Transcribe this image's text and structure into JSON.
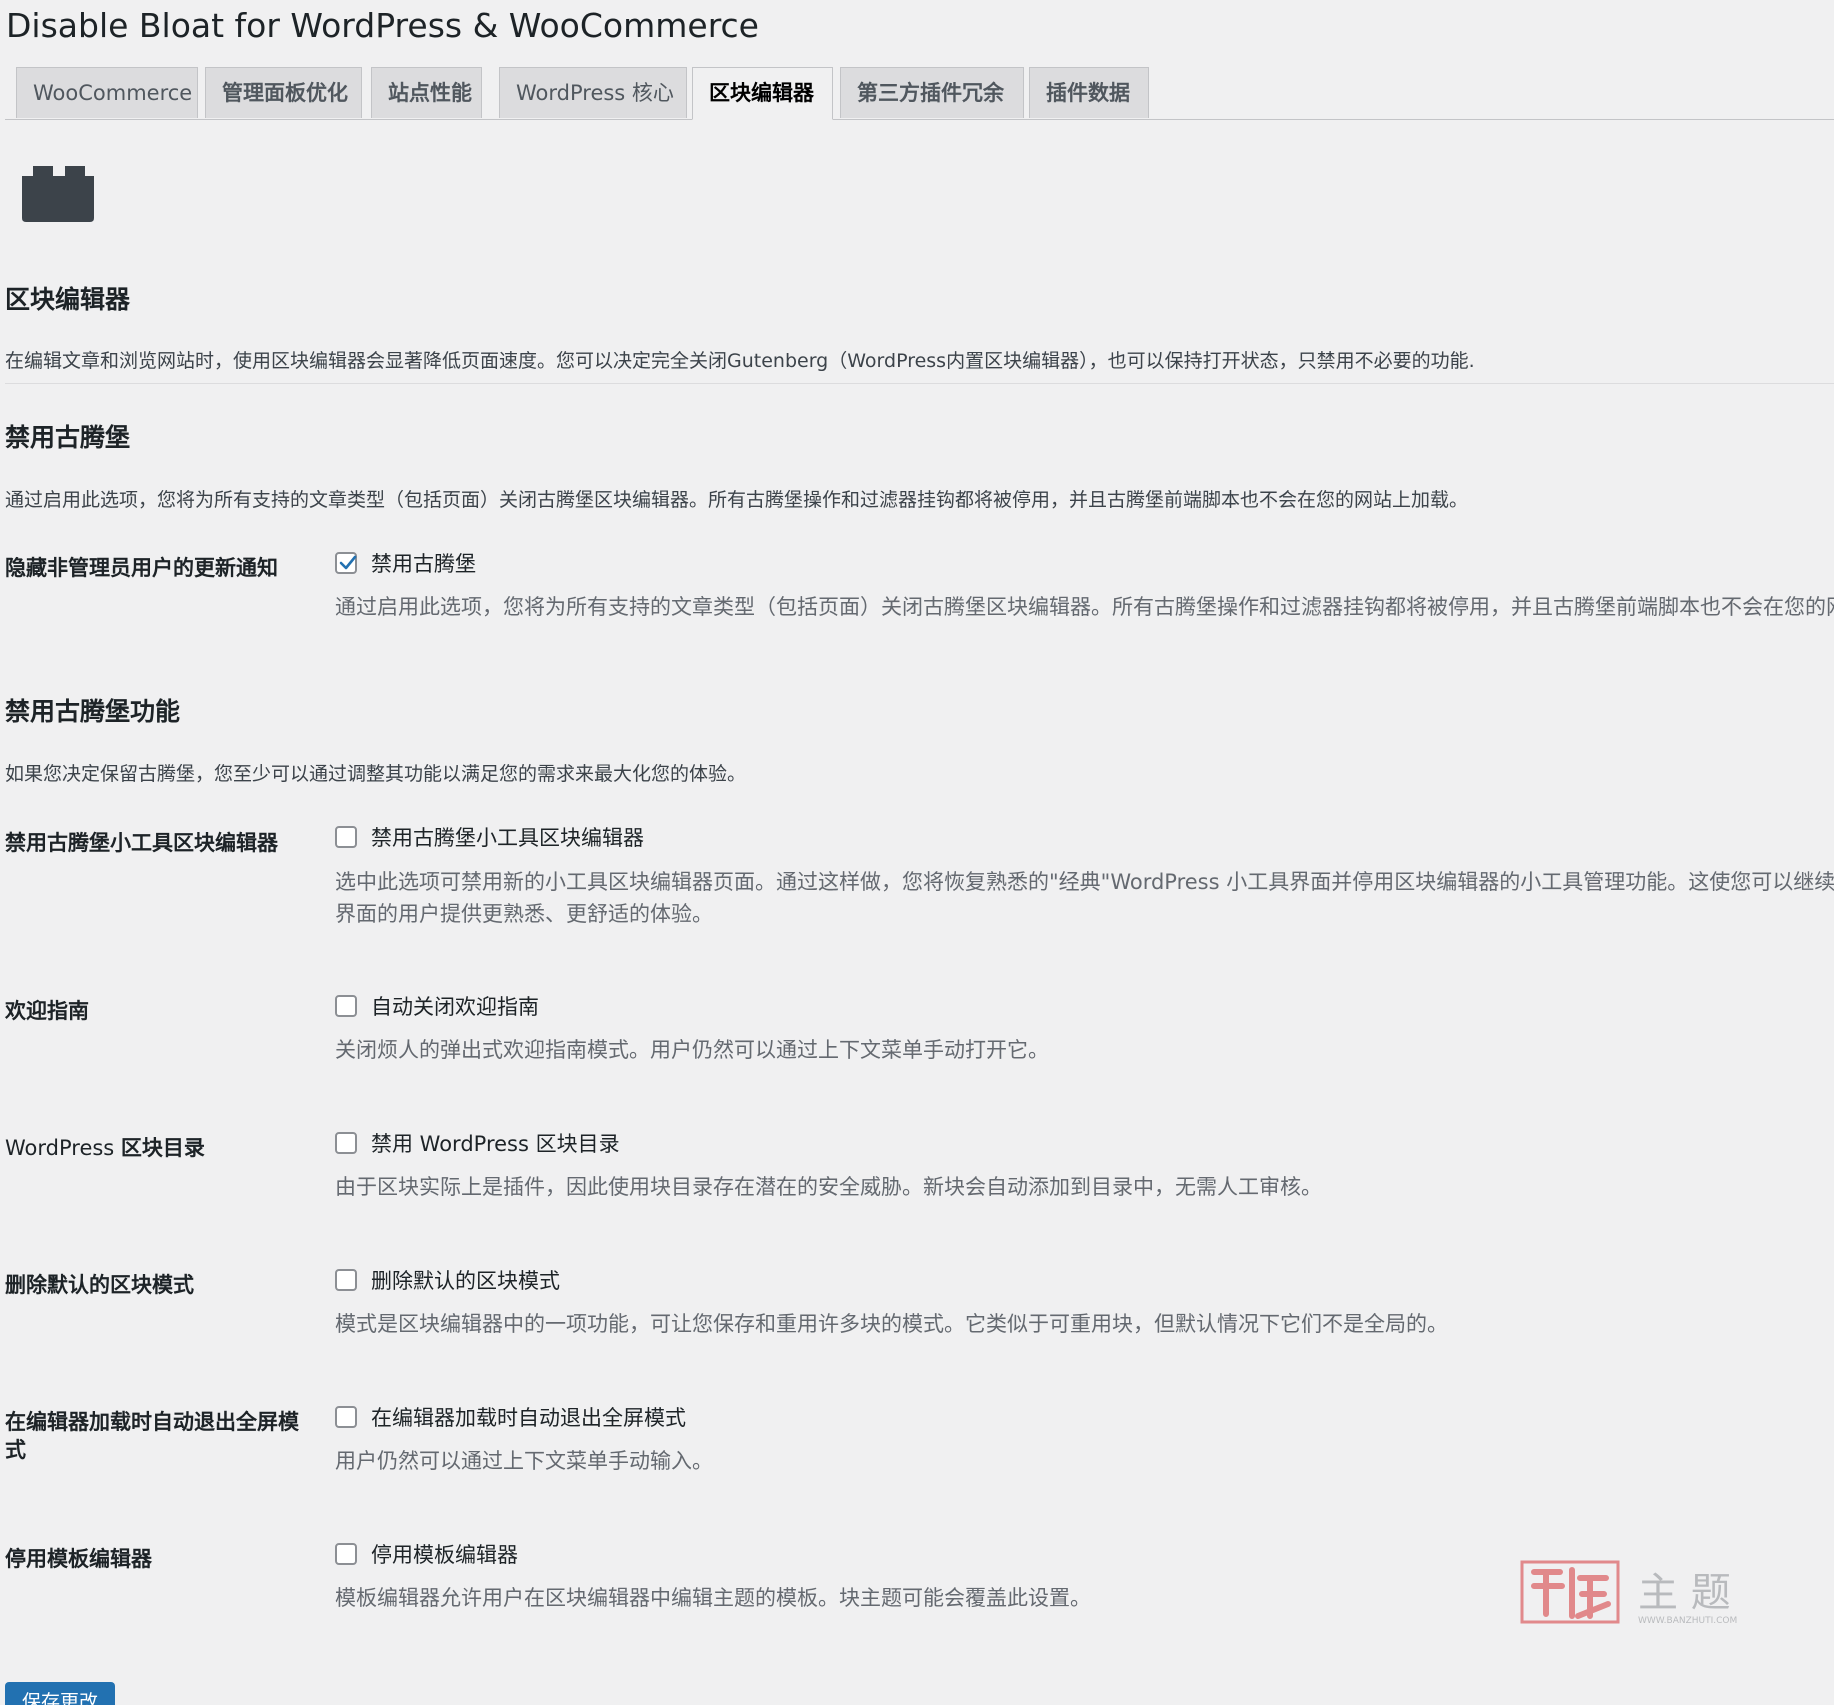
{
  "page": {
    "title": "Disable Bloat for WordPress & WooCommerce"
  },
  "tabs": [
    {
      "label": "WooCommerce"
    },
    {
      "label": "管理面板优化"
    },
    {
      "label": "站点性能"
    },
    {
      "label": "WordPress 核心"
    },
    {
      "label": "区块编辑器",
      "active": true
    },
    {
      "label": "第三方插件冗余"
    },
    {
      "label": "插件数据"
    }
  ],
  "section_main": {
    "icon": "block-icon",
    "title": "区块编辑器",
    "description": "在编辑文章和浏览网站时，使用区块编辑器会显著降低页面速度。您可以决定完全关闭Gutenberg（WordPress内置区块编辑器），也可以保持打开状态，只禁用不必要的功能."
  },
  "section_disable": {
    "title": "禁用古腾堡",
    "description": "通过启用此选项，您将为所有支持的文章类型（包括页面）关闭古腾堡区块编辑器。所有古腾堡操作和过滤器挂钩都将被停用，并且古腾堡前端脚本也不会在您的网站上加载。"
  },
  "section_features": {
    "title": "禁用古腾堡功能",
    "description": "如果您决定保留古腾堡，您至少可以通过调整其功能以满足您的需求来最大化您的体验。"
  },
  "settings": [
    {
      "label": "隐藏非管理员用户的更新通知",
      "checkbox_label": "禁用古腾堡",
      "checked": true,
      "help": [
        "通过启用此选项，您将为所有支持的文章类型（包括页面）关闭古腾堡区块编辑器。所有古腾堡操作和过滤器挂钩都将被停用，并且古腾堡前端脚本也不会在您的网"
      ]
    },
    {
      "label": "禁用古腾堡小工具区块编辑器",
      "checkbox_label": "禁用古腾堡小工具区块编辑器",
      "checked": false,
      "help": [
        "选中此选项可禁用新的小工具区块编辑器页面。通过这样做，您将恢复熟悉的\"经典\"WordPress 小工具界面并停用区块编辑器的小工具管理功能。这使您可以继续以",
        "界面的用户提供更熟悉、更舒适的体验。"
      ]
    },
    {
      "label": "欢迎指南",
      "checkbox_label": "自动关闭欢迎指南",
      "checked": false,
      "help": [
        "关闭烦人的弹出式欢迎指南模式。用户仍然可以通过上下文菜单手动打开它。"
      ]
    },
    {
      "label_prefix": "WordPress ",
      "label": "区块目录",
      "checkbox_label": "禁用 WordPress 区块目录",
      "checked": false,
      "help": [
        "由于区块实际上是插件，因此使用块目录存在潜在的安全威胁。新块会自动添加到目录中，无需人工审核。"
      ]
    },
    {
      "label": "删除默认的区块模式",
      "checkbox_label": "删除默认的区块模式",
      "checked": false,
      "help": [
        "模式是区块编辑器中的一项功能，可让您保存和重用许多块的模式。它类似于可重用块，但默认情况下它们不是全局的。"
      ]
    },
    {
      "label": "在编辑器加载时自动退出全屏模式",
      "checkbox_label": "在编辑器加载时自动退出全屏模式",
      "checked": false,
      "help": [
        "用户仍然可以通过上下文菜单手动输入。"
      ]
    },
    {
      "label": "停用模板编辑器",
      "checkbox_label": "停用模板编辑器",
      "checked": false,
      "help": [
        "模板编辑器允许用户在区块编辑器中编辑主题的模板。块主题可能会覆盖此设置。"
      ]
    }
  ],
  "watermark": {
    "text": "主 题",
    "subtext": "WWW.BANZHUTI.COM"
  },
  "save_button": {
    "label": "保存更改"
  },
  "colors": {
    "accent": "#2271b1",
    "background": "#f0f0f1",
    "tab_inactive": "#dcdcde",
    "icon": "#3c434a",
    "watermark": "#d63638"
  }
}
